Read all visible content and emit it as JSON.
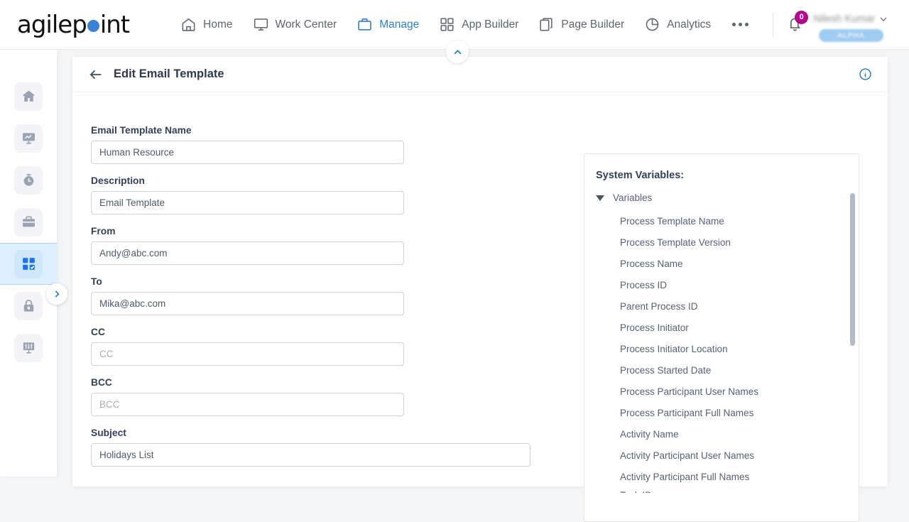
{
  "header": {
    "logo_text_1": "agilep",
    "logo_text_2": "int",
    "nav": [
      {
        "label": "Home",
        "icon": "home-icon",
        "active": false
      },
      {
        "label": "Work Center",
        "icon": "monitor-icon",
        "active": false
      },
      {
        "label": "Manage",
        "icon": "briefcase-icon",
        "active": true
      },
      {
        "label": "App Builder",
        "icon": "grid-icon",
        "active": false
      },
      {
        "label": "Page Builder",
        "icon": "pages-icon",
        "active": false
      },
      {
        "label": "Analytics",
        "icon": "pie-chart-icon",
        "active": false
      }
    ],
    "more_label": "•••",
    "notification_count": "0",
    "user_name": "Nilesh Kumar",
    "environment_badge": "ALPHA"
  },
  "sidebar": {
    "items": [
      {
        "name": "home",
        "icon": "home-icon",
        "active": false
      },
      {
        "name": "analytics",
        "icon": "monitor-chart-icon",
        "active": false
      },
      {
        "name": "timer",
        "icon": "stopwatch-icon",
        "active": false
      },
      {
        "name": "work",
        "icon": "briefcase-icon",
        "active": false
      },
      {
        "name": "app-builder",
        "icon": "grid-check-icon",
        "active": true
      },
      {
        "name": "access",
        "icon": "lock-icon",
        "active": false
      },
      {
        "name": "settings",
        "icon": "sliders-icon",
        "active": false
      }
    ]
  },
  "page": {
    "title": "Edit Email Template",
    "back_icon": "arrow-left-icon",
    "info_icon": "info-circle-icon"
  },
  "form": {
    "fields": [
      {
        "label": "Email Template Name",
        "value": "Human Resource",
        "placeholder": "",
        "name": "email-template-name",
        "wide": false
      },
      {
        "label": "Description",
        "value": "Email Template",
        "placeholder": "",
        "name": "description",
        "wide": false
      },
      {
        "label": "From",
        "value": "Andy@abc.com",
        "placeholder": "",
        "name": "from",
        "wide": false
      },
      {
        "label": "To",
        "value": "Mika@abc.com",
        "placeholder": "",
        "name": "to",
        "wide": false
      },
      {
        "label": "CC",
        "value": "",
        "placeholder": "CC",
        "name": "cc",
        "wide": false
      },
      {
        "label": "BCC",
        "value": "",
        "placeholder": "BCC",
        "name": "bcc",
        "wide": false
      },
      {
        "label": "Subject",
        "value": "Holidays List",
        "placeholder": "",
        "name": "subject",
        "wide": true
      }
    ]
  },
  "variables_panel": {
    "title": "System Variables:",
    "root_label": "Variables",
    "root_expanded": true,
    "items": [
      "Process Template Name",
      "Process Template Version",
      "Process Name",
      "Process ID",
      "Parent Process ID",
      "Process Initiator",
      "Process Initiator Location",
      "Process Started Date",
      "Process Participant User Names",
      "Process Participant Full Names",
      "Activity Name",
      "Activity Participant User Names",
      "Activity Participant Full Names",
      "Task ID"
    ]
  },
  "colors": {
    "accent_blue": "#2b7fd4",
    "logo_dot": "#3b82d6",
    "badge_magenta": "#b5068f",
    "alpha_pill": "#9fcbf0",
    "active_rail": "#ddeeff"
  }
}
